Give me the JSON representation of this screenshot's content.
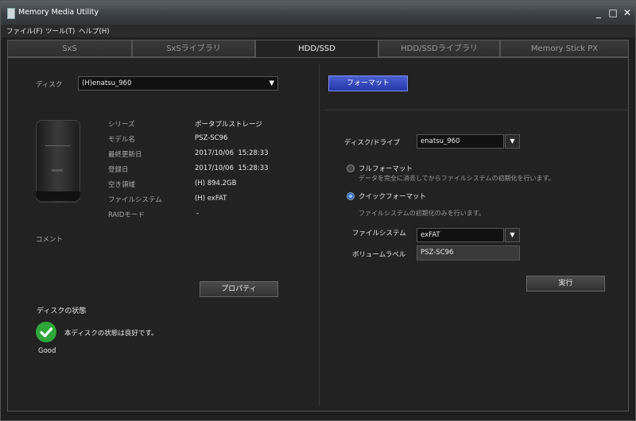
{
  "window": {
    "title": "Memory Media Utility",
    "controls": [
      "_",
      "□",
      "✕"
    ]
  },
  "menu": [
    "ファイル(F)",
    "ツール(T)",
    "ヘルプ(H)"
  ],
  "tabs": [
    {
      "label": "SxS",
      "active": false
    },
    {
      "label": "SxSライブラリ",
      "active": false
    },
    {
      "label": "HDD/SSD",
      "active": true
    },
    {
      "label": "HDD/SSDライブラリ",
      "active": false
    },
    {
      "label": "Memory Stick PX",
      "active": false
    }
  ],
  "left": {
    "disk_label": "ディスク",
    "disk_value": "(H)enatsu_960",
    "info": [
      {
        "label": "シリーズ",
        "value": "ポータブルストレージ"
      },
      {
        "label": "モデル名",
        "value": "PSZ-SC96"
      },
      {
        "label": "最終更新日",
        "value": "2017/10/06  15:28:33"
      },
      {
        "label": "登録日",
        "value": "2017/10/06  15:28:33"
      },
      {
        "label": "空き領域",
        "value": "(H) 894.2GB"
      },
      {
        "label": "ファイルシステム",
        "value": "(H) exFAT"
      },
      {
        "label": "RAIDモード",
        "value": "-"
      }
    ],
    "comment_label": "コメント",
    "properties_button": "プロパティ",
    "disk_status_title": "ディスクの状態",
    "disk_status_message": "本ディスクの状態は良好です。",
    "disk_status": "Good",
    "status_color": "#2fa53a"
  },
  "right": {
    "format_button": "フォーマット",
    "drive_label": "ディスク/ドライブ",
    "drive_value": "enatsu_960",
    "full_format_label": "フルフォーマット",
    "full_format_desc": "データを完全に消去してからファイルシステムの初期化を行います。",
    "quick_format_label": "クイックフォーマット",
    "quick_format_desc": "ファイルシステムの初期化のみを行います。",
    "selected_format": "quick",
    "filesystem_label": "ファイルシステム",
    "filesystem_value": "exFAT",
    "volume_label_label": "ボリュームラベル",
    "volume_label_value": "PSZ-SC96",
    "execute_button": "実行"
  }
}
